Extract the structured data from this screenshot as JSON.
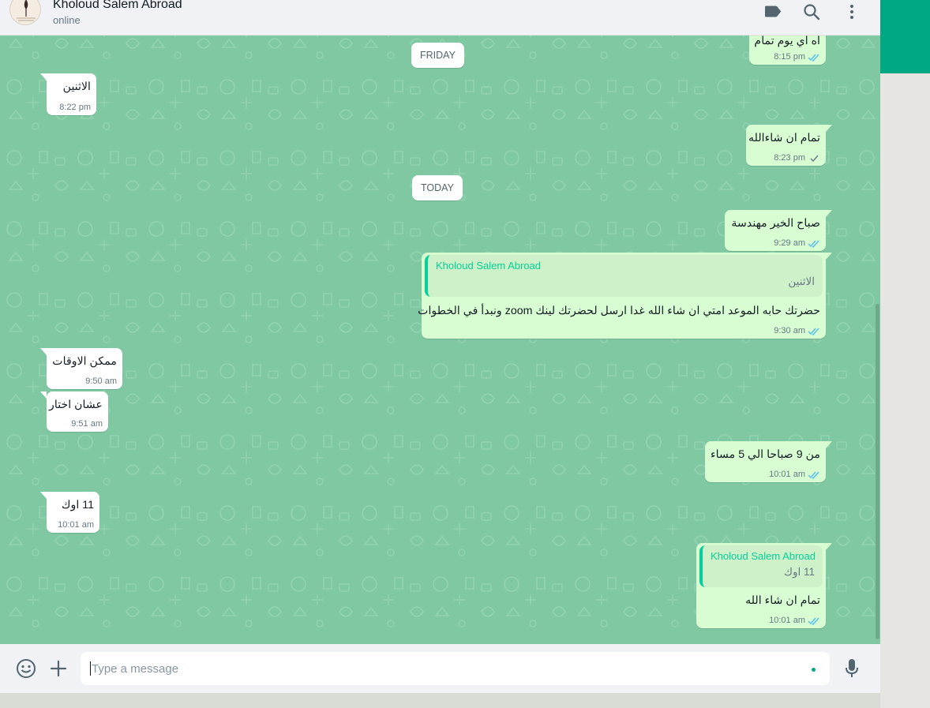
{
  "header": {
    "contact_name": "Kholoud Salem Abroad",
    "status": "online",
    "icons": [
      "label-icon",
      "search-icon",
      "menu-icon"
    ]
  },
  "date_separators": {
    "friday": "FRIDAY",
    "today": "TODAY"
  },
  "messages": [
    {
      "dir": "out",
      "text": "اه اي يوم تمام",
      "time": "8:15 pm",
      "status": "read"
    },
    {
      "dir": "in",
      "text": "الاثنين",
      "time": "8:22 pm"
    },
    {
      "dir": "out",
      "text": "تمام ان شاءالله",
      "time": "8:23 pm",
      "status": "sent"
    },
    {
      "dir": "out",
      "text": "صباح الخير مهندسة",
      "time": "9:29 am",
      "status": "read"
    },
    {
      "dir": "out",
      "quote_name": "Kholoud Salem Abroad",
      "quote_text": "الاثنين",
      "text": "حضرتك حابه الموعد امتي ان شاء الله غدا ارسل لحضرتك لينك zoom ونبدأ في الخطوات",
      "time": "9:30 am",
      "status": "read"
    },
    {
      "dir": "in",
      "text": "ممكن الاوقات",
      "time": "9:50 am"
    },
    {
      "dir": "in",
      "text": "عشان اختار",
      "time": "9:51 am"
    },
    {
      "dir": "out",
      "text": "من 9 صباحا الي 5 مساء",
      "time": "10:01 am",
      "status": "read"
    },
    {
      "dir": "in",
      "text": "11 اوك",
      "time": "10:01 am"
    },
    {
      "dir": "out",
      "quote_name": "Kholoud Salem Abroad",
      "quote_text": "11 اوك",
      "text": "تمام ان شاء الله",
      "time": "10:01 am",
      "status": "read"
    }
  ],
  "composer": {
    "placeholder": "Type a message",
    "value": ""
  },
  "colors": {
    "accent": "#00a884",
    "wallpaper": "#7fc8a2",
    "outgoing": "#d9fdd3",
    "incoming": "#ffffff",
    "read_tick": "#53bdeb"
  }
}
